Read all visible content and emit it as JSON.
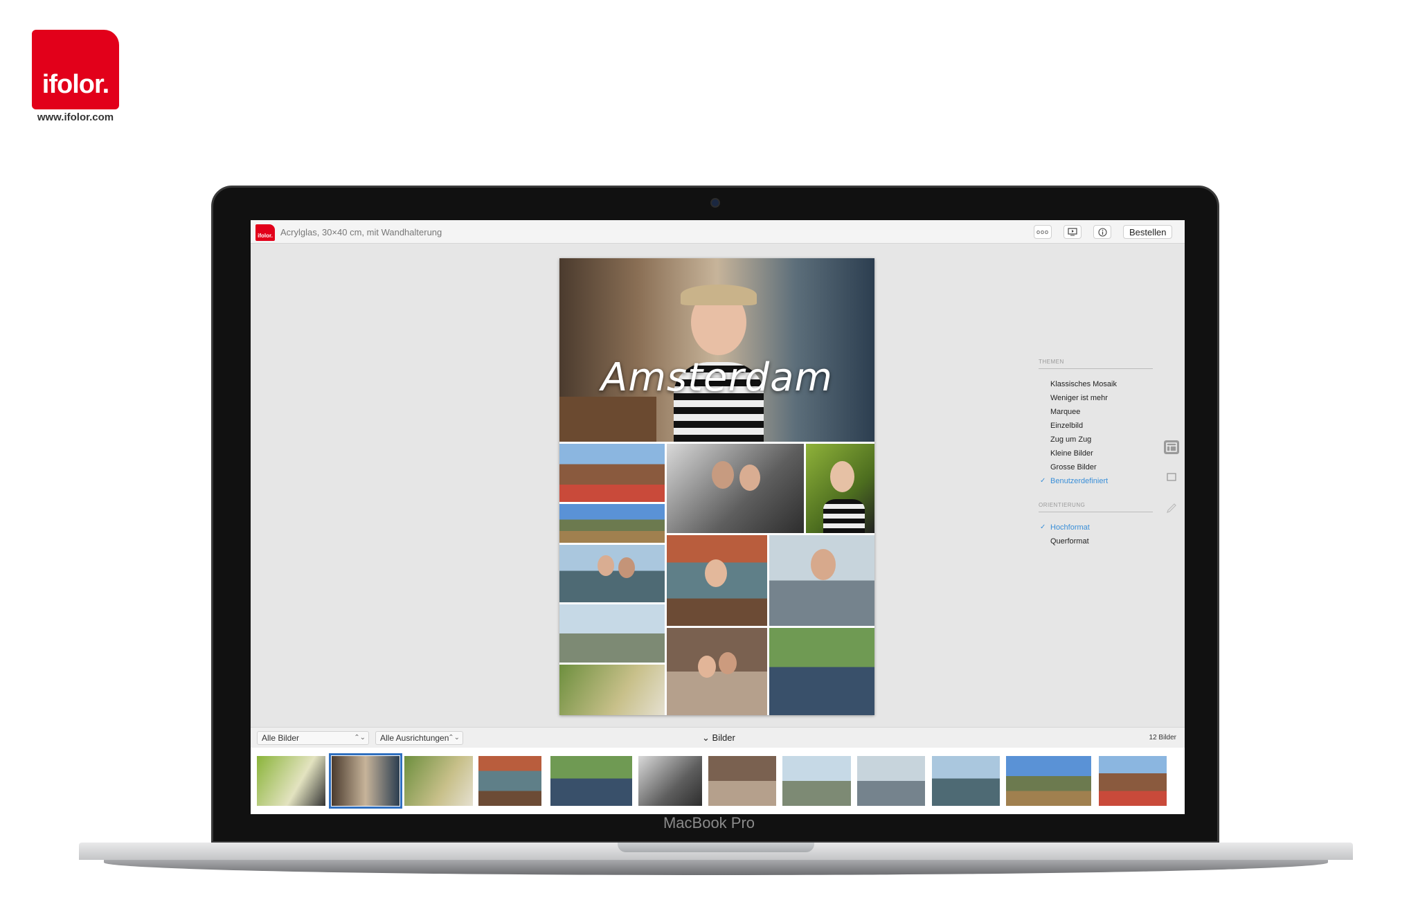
{
  "brand": {
    "logo_text": "ifolor.",
    "url": "www.ifolor.com"
  },
  "device": {
    "label": "MacBook Pro"
  },
  "app": {
    "icon_text": "ifolor.",
    "document_title": "Acrylglas, 30×40 cm, mit Wandhalterung",
    "toolbar": {
      "more_label": "ooo",
      "preview_icon": "play-screen-icon",
      "info_icon": "info-icon",
      "order_label": "Bestellen"
    }
  },
  "canvas": {
    "poster_title": "Amsterdam"
  },
  "panel": {
    "themes": {
      "title": "THEMEN",
      "items": [
        {
          "label": "Klassisches Mosaik",
          "active": false
        },
        {
          "label": "Weniger ist mehr",
          "active": false
        },
        {
          "label": "Marquee",
          "active": false
        },
        {
          "label": "Einzelbild",
          "active": false
        },
        {
          "label": "Zug um Zug",
          "active": false
        },
        {
          "label": "Kleine Bilder",
          "active": false
        },
        {
          "label": "Grosse Bilder",
          "active": false
        },
        {
          "label": "Benutzerdefiniert",
          "active": true
        }
      ]
    },
    "orientation": {
      "title": "ORIENTIERUNG",
      "items": [
        {
          "label": "Hochformat",
          "active": true
        },
        {
          "label": "Querformat",
          "active": false
        }
      ]
    },
    "side_icons": [
      "layout-icon",
      "frame-icon",
      "pencil-icon"
    ]
  },
  "filmstrip": {
    "filter_images": "Alle Bilder",
    "filter_orientation": "Alle Ausrichtungen",
    "toggle_label": "Bilder",
    "count_label": "12 Bilder",
    "selected_index": 1,
    "thumbnail_count": 12
  },
  "colors": {
    "brand_red": "#e2001a",
    "accent_blue": "#3a8fd8",
    "selection_blue": "#2f6fbf"
  }
}
